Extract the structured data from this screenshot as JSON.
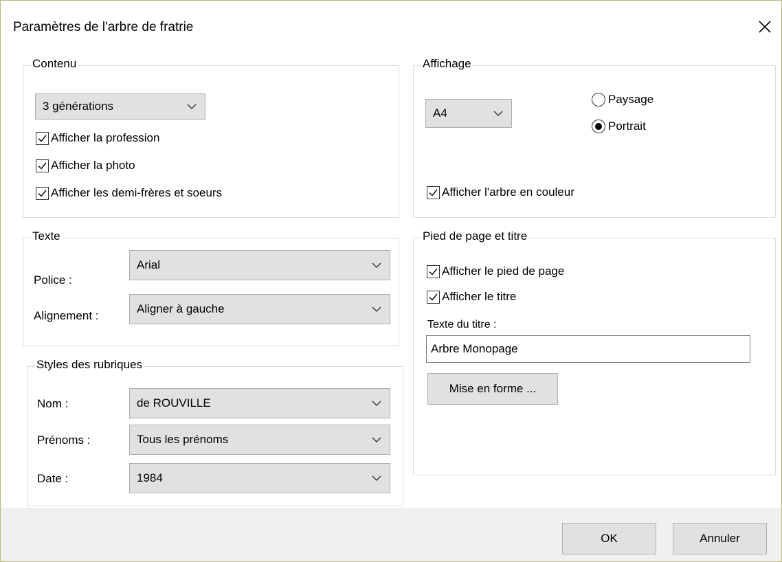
{
  "window": {
    "title": "Paramètres de l'arbre de fratrie"
  },
  "contenu": {
    "label": "Contenu",
    "generations": "3 générations",
    "checks": [
      {
        "label": "Afficher la profession",
        "checked": true
      },
      {
        "label": "Afficher la photo",
        "checked": true
      },
      {
        "label": "Afficher les demi-frères et soeurs",
        "checked": true
      }
    ]
  },
  "affichage": {
    "label": "Affichage",
    "format": "A4",
    "orientation": [
      {
        "label": "Paysage",
        "selected": false
      },
      {
        "label": "Portrait",
        "selected": true
      }
    ],
    "couleur": {
      "label": "Afficher l'arbre en couleur",
      "checked": true
    }
  },
  "texte": {
    "label": "Texte",
    "police_label": "Police :",
    "police_value": "Arial",
    "alignement_label": "Alignement :",
    "alignement_value": "Aligner à gauche"
  },
  "pied": {
    "label": "Pied de page et titre",
    "check_pied": {
      "label": "Afficher le pied de page",
      "checked": true
    },
    "check_titre": {
      "label": "Afficher le titre",
      "checked": true
    },
    "texte_titre_label": "Texte du titre :",
    "texte_titre_value": "Arbre Monopage",
    "mise_en_forme": "Mise en forme ..."
  },
  "styles": {
    "label": "Styles des rubriques",
    "nom_label": "Nom :",
    "nom_value": "de ROUVILLE",
    "prenoms_label": "Prénoms :",
    "prenoms_value": "Tous les prénoms",
    "date_label": "Date :",
    "date_value": "1984"
  },
  "buttons": {
    "ok": "OK",
    "cancel": "Annuler"
  }
}
